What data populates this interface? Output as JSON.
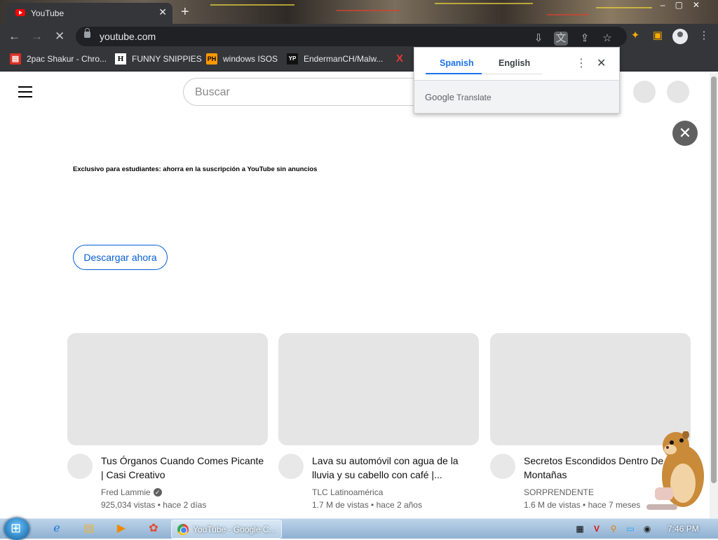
{
  "browser": {
    "tab_title": "YouTube",
    "url": "youtube.com",
    "tab_close": "✕",
    "new_tab": "+"
  },
  "bookmarks": [
    {
      "label": "2pac Shakur - Chro...",
      "icon": "calendar-icon"
    },
    {
      "label": "FUNNY SNIPPIES",
      "icon": "h-logo-icon"
    },
    {
      "label": "windows ISOS",
      "icon": "ph-logo-icon"
    },
    {
      "label": "EndermanCH/Malw...",
      "icon": "yp-logo-icon"
    },
    {
      "label": "X",
      "icon": "x-logo-icon"
    }
  ],
  "translate_popup": {
    "languages": [
      "Spanish",
      "English"
    ],
    "active_language": "Spanish",
    "footer_google": "Google",
    "footer_translate": "Translate",
    "accent_color": "#1a73e8"
  },
  "youtube": {
    "search_placeholder": "Buscar",
    "promo_text": "Exclusivo para estudiantes: ahorra en la suscripción a YouTube sin anuncios",
    "download_button": "Descargar ahora",
    "videos": [
      {
        "title": "Tus Órganos Cuando Comes Picante | Casi Creativo",
        "channel": "Fred Lammie",
        "verified": true,
        "views": "925,034 vistas",
        "age": "hace 2 días"
      },
      {
        "title": "Lava su automóvil con agua de la lluvia y su cabello con café |...",
        "channel": "TLC Latinoamérica",
        "verified": false,
        "views": "1.7 M de vistas",
        "age": "hace 2 años"
      },
      {
        "title": "Secretos Escondidos Dentro De Montañas",
        "channel": "SORPRENDENTE",
        "verified": false,
        "views": "1.6 M de vistas",
        "age": "hace 7 meses"
      }
    ],
    "meta_separator": "•"
  },
  "taskbar": {
    "active_task": "YouTube - Google C...",
    "clock": "7:46 PM"
  }
}
